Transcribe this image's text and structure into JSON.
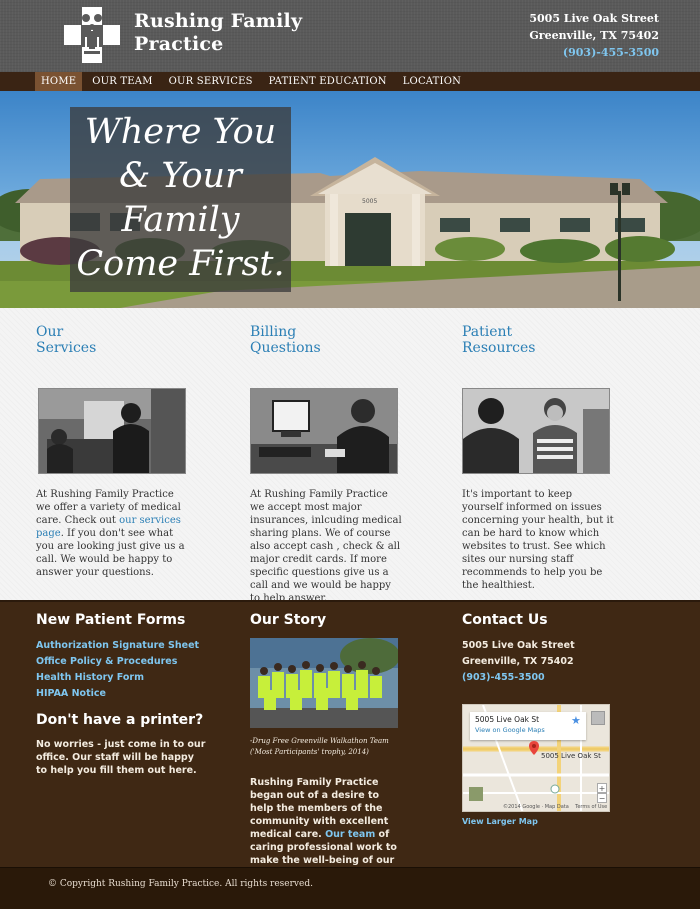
{
  "header": {
    "brand_line1": "Rushing Family",
    "brand_line2": "Practice",
    "address_line1": "5005 Live Oak Street",
    "address_line2": "Greenville, TX 75402",
    "phone": "(903)-455-3500"
  },
  "nav": {
    "items": [
      {
        "label": "HOME",
        "active": true
      },
      {
        "label": "OUR TEAM"
      },
      {
        "label": "OUR SERVICES"
      },
      {
        "label": "PATIENT EDUCATION"
      },
      {
        "label": "LOCATION"
      }
    ]
  },
  "hero": {
    "line1": "Where You",
    "line2": "& Your",
    "line3": "Family",
    "line4": "Come First.",
    "sign": "5005"
  },
  "columns": [
    {
      "title_line1": "Our",
      "title_line2": "Services",
      "text_before": "At Rushing Family Practice we offer a variety of medical care. Check out ",
      "link": "our services page",
      "text_after": ". If you don't see what you are looking just give us a call. We would be happy to answer your questions."
    },
    {
      "title_line1": "Billing",
      "title_line2": "Questions",
      "text": "At Rushing Family Practice we accept most major insurances, inlcuding medical sharing plans. We of course also accept cash , check & all major credit cards. If more specific questions give us a call and we would be happy to help answer."
    },
    {
      "title_line1": "Patient",
      "title_line2": "Resources",
      "text": "It's important to keep yourself informed on issues concerning your health, but it can be hard to know which websites to trust. See which sites our nursing staff recommends to help you be the healthiest."
    }
  ],
  "footer": {
    "forms_title": "New Patient Forms",
    "forms": [
      "Authorization Signature Sheet",
      "Office Policy & Procedures",
      "Health History Form",
      "HIPAA Notice"
    ],
    "printer_title": "Don't have a printer?",
    "printer_text": "No worries - just come in to our office. Our staff will be happy to help you fill them out here.",
    "story_title": "Our Story",
    "story_caption_line1": "-Drug Free Greenville Walkathon Team",
    "story_caption_line2": "('Most Participants' trophy, 2014)",
    "story_text_before": "Rushing Family Practice began out of a desire to help the members of the community with excellent medical care. ",
    "story_link": "Our team",
    "story_text_after": " of caring professional work to make the well-being of our patients a top priority.",
    "contact_title": "Contact Us",
    "contact_line1": "5005 Live Oak Street",
    "contact_line2": "Greenville, TX 75402",
    "contact_phone": "(903)-455-3500",
    "map_card_title": "5005 Live Oak St",
    "map_card_link": "View on Google Maps",
    "map_pin_label": "5005 Live Oak St",
    "map_credit": "©2014 Google · Map Data    Terms of Use",
    "view_larger": "View Larger Map"
  },
  "copyright": "© Copyright Rushing Family Practice. All rights reserved.",
  "colors": {
    "header_bg": "#5a5a5a",
    "nav_bg": "#3a2414",
    "accent_blue": "#2b7fb5",
    "link_light_blue": "#7fc6ef",
    "footer_bg": "#3f2814"
  }
}
